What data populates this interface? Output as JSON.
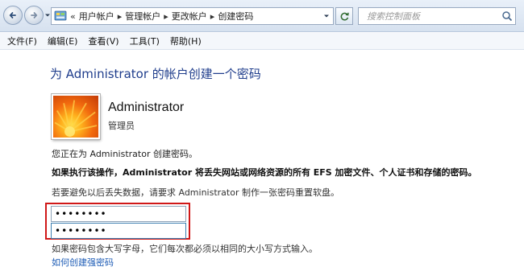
{
  "nav": {
    "breadcrumbs": [
      "用户帐户",
      "管理帐户",
      "更改帐户",
      "创建密码"
    ],
    "breadcrumb_overflow": "«",
    "separator": "▸",
    "search_placeholder": "搜索控制面板"
  },
  "menu": {
    "items": [
      "文件(F)",
      "编辑(E)",
      "查看(V)",
      "工具(T)",
      "帮助(H)"
    ]
  },
  "content": {
    "title": "为 Administrator 的帐户创建一个密码",
    "user_name": "Administrator",
    "user_role": "管理员",
    "intro": "您正在为 Administrator 创建密码。",
    "warning": "如果执行该操作，Administrator 将丢失网站或网络资源的所有 EFS 加密文件、个人证书和存储的密码。",
    "hint": "若要避免以后丢失数据，请要求 Administrator 制作一张密码重置软盘。",
    "password_value": "••••••••",
    "confirm_value": "••••••••",
    "caps_note": "如果密码包含大写字母，它们每次都必须以相同的大小写方式输入。",
    "strong_password_link": "如何创建强密码"
  },
  "colors": {
    "title": "#1f3d8c",
    "link": "#1c5bb5",
    "highlight_frame": "#d01818"
  },
  "icons": [
    "back-arrow-icon",
    "forward-arrow-icon",
    "control-panel-icon",
    "refresh-icon",
    "search-icon",
    "user-picture-flower"
  ]
}
